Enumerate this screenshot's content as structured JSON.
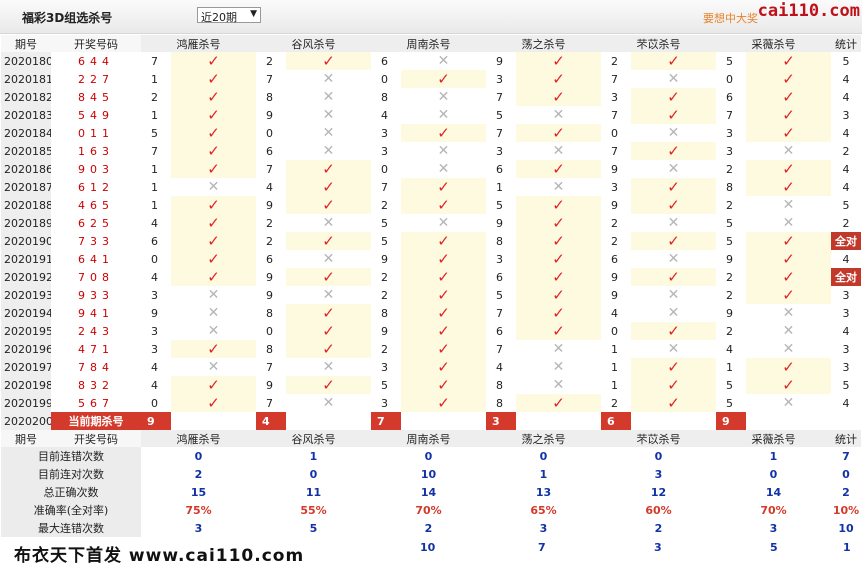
{
  "title": "福彩3D组选杀号",
  "period_select": {
    "value": "近20期"
  },
  "promo_text": "要想中大奖",
  "logo_text": "cai110.com",
  "columns": {
    "issue": "期号",
    "draw": "开奖号码",
    "experts": [
      "鸿雁杀号",
      "谷风杀号",
      "周南杀号",
      "荡之杀号",
      "芣苡杀号",
      "采薇杀号"
    ],
    "stat": "统计"
  },
  "rows": [
    {
      "issue": "2020180",
      "draw": "644",
      "kills": [
        "7",
        "2",
        "6",
        "9",
        "2",
        "5"
      ],
      "hits": [
        1,
        1,
        0,
        1,
        1,
        1
      ],
      "stat": "5"
    },
    {
      "issue": "2020181",
      "draw": "227",
      "kills": [
        "1",
        "7",
        "0",
        "3",
        "7",
        "0"
      ],
      "hits": [
        1,
        0,
        1,
        1,
        0,
        1
      ],
      "stat": "4"
    },
    {
      "issue": "2020182",
      "draw": "845",
      "kills": [
        "2",
        "8",
        "8",
        "7",
        "3",
        "6"
      ],
      "hits": [
        1,
        0,
        0,
        1,
        1,
        1
      ],
      "stat": "4"
    },
    {
      "issue": "2020183",
      "draw": "549",
      "kills": [
        "1",
        "9",
        "4",
        "5",
        "7",
        "7"
      ],
      "hits": [
        1,
        0,
        0,
        0,
        1,
        1
      ],
      "stat": "3"
    },
    {
      "issue": "2020184",
      "draw": "011",
      "kills": [
        "5",
        "0",
        "3",
        "7",
        "0",
        "3"
      ],
      "hits": [
        1,
        0,
        1,
        1,
        0,
        1
      ],
      "stat": "4"
    },
    {
      "issue": "2020185",
      "draw": "163",
      "kills": [
        "7",
        "6",
        "3",
        "3",
        "7",
        "3"
      ],
      "hits": [
        1,
        0,
        0,
        0,
        1,
        0
      ],
      "stat": "2"
    },
    {
      "issue": "2020186",
      "draw": "903",
      "kills": [
        "1",
        "7",
        "0",
        "6",
        "9",
        "2"
      ],
      "hits": [
        1,
        1,
        0,
        1,
        0,
        1
      ],
      "stat": "4"
    },
    {
      "issue": "2020187",
      "draw": "612",
      "kills": [
        "1",
        "4",
        "7",
        "1",
        "3",
        "8"
      ],
      "hits": [
        0,
        1,
        1,
        0,
        1,
        1
      ],
      "stat": "4"
    },
    {
      "issue": "2020188",
      "draw": "465",
      "kills": [
        "1",
        "9",
        "2",
        "5",
        "9",
        "2"
      ],
      "hits": [
        1,
        1,
        1,
        1,
        1,
        0
      ],
      "stat": "5"
    },
    {
      "issue": "2020189",
      "draw": "625",
      "kills": [
        "4",
        "2",
        "5",
        "9",
        "2",
        "5"
      ],
      "hits": [
        1,
        0,
        0,
        1,
        0,
        0
      ],
      "stat": "2"
    },
    {
      "issue": "2020190",
      "draw": "733",
      "kills": [
        "6",
        "2",
        "5",
        "8",
        "2",
        "5"
      ],
      "hits": [
        1,
        1,
        1,
        1,
        1,
        1
      ],
      "stat": "全对"
    },
    {
      "issue": "2020191",
      "draw": "641",
      "kills": [
        "0",
        "6",
        "9",
        "3",
        "6",
        "9"
      ],
      "hits": [
        1,
        0,
        1,
        1,
        0,
        1
      ],
      "stat": "4"
    },
    {
      "issue": "2020192",
      "draw": "708",
      "kills": [
        "4",
        "9",
        "2",
        "6",
        "9",
        "2"
      ],
      "hits": [
        1,
        1,
        1,
        1,
        1,
        1
      ],
      "stat": "全对"
    },
    {
      "issue": "2020193",
      "draw": "933",
      "kills": [
        "3",
        "9",
        "2",
        "5",
        "9",
        "2"
      ],
      "hits": [
        0,
        0,
        1,
        1,
        0,
        1
      ],
      "stat": "3"
    },
    {
      "issue": "2020194",
      "draw": "941",
      "kills": [
        "9",
        "8",
        "8",
        "7",
        "4",
        "9"
      ],
      "hits": [
        0,
        1,
        1,
        1,
        0,
        0
      ],
      "stat": "3"
    },
    {
      "issue": "2020195",
      "draw": "243",
      "kills": [
        "3",
        "0",
        "9",
        "6",
        "0",
        "2"
      ],
      "hits": [
        0,
        1,
        1,
        1,
        1,
        0
      ],
      "stat": "4"
    },
    {
      "issue": "2020196",
      "draw": "471",
      "kills": [
        "3",
        "8",
        "2",
        "7",
        "1",
        "4"
      ],
      "hits": [
        1,
        1,
        1,
        0,
        0,
        0
      ],
      "stat": "3"
    },
    {
      "issue": "2020197",
      "draw": "784",
      "kills": [
        "4",
        "7",
        "3",
        "4",
        "1",
        "1"
      ],
      "hits": [
        0,
        0,
        1,
        0,
        1,
        1
      ],
      "stat": "3"
    },
    {
      "issue": "2020198",
      "draw": "832",
      "kills": [
        "4",
        "9",
        "5",
        "8",
        "1",
        "5"
      ],
      "hits": [
        1,
        1,
        1,
        0,
        1,
        1
      ],
      "stat": "5"
    },
    {
      "issue": "2020199",
      "draw": "567",
      "kills": [
        "0",
        "7",
        "3",
        "8",
        "2",
        "5"
      ],
      "hits": [
        1,
        0,
        1,
        1,
        1,
        0
      ],
      "stat": "4"
    }
  ],
  "current": {
    "issue": "2020200",
    "label": "当前期杀号",
    "kills": [
      "9",
      "4",
      "7",
      "3",
      "6",
      "9"
    ]
  },
  "summary": [
    {
      "label": "目前连错次数",
      "values": [
        "0",
        "1",
        "0",
        "0",
        "0",
        "1",
        "7"
      ],
      "red": false
    },
    {
      "label": "目前连对次数",
      "values": [
        "2",
        "0",
        "10",
        "1",
        "3",
        "0",
        "0"
      ],
      "red": false
    },
    {
      "label": "总正确次数",
      "values": [
        "15",
        "11",
        "14",
        "13",
        "12",
        "14",
        "2"
      ],
      "red": false
    },
    {
      "label": "准确率(全对率)",
      "values": [
        "75%",
        "55%",
        "70%",
        "65%",
        "60%",
        "70%",
        "10%"
      ],
      "red": true
    },
    {
      "label": "最大连错次数",
      "values": [
        "3",
        "5",
        "2",
        "3",
        "2",
        "3",
        "10"
      ],
      "red": false
    }
  ],
  "extra_row": [
    "10",
    "7",
    "3",
    "5",
    "1"
  ],
  "footer": "布衣天下首发 www.cai110.com",
  "colors": {
    "check": "#e02424",
    "cross": "#b5b5b5",
    "badge": "#c0392b",
    "stat_value": "#1232a5",
    "percent": "#d43a2a",
    "hit_bg": "#fefae0"
  }
}
